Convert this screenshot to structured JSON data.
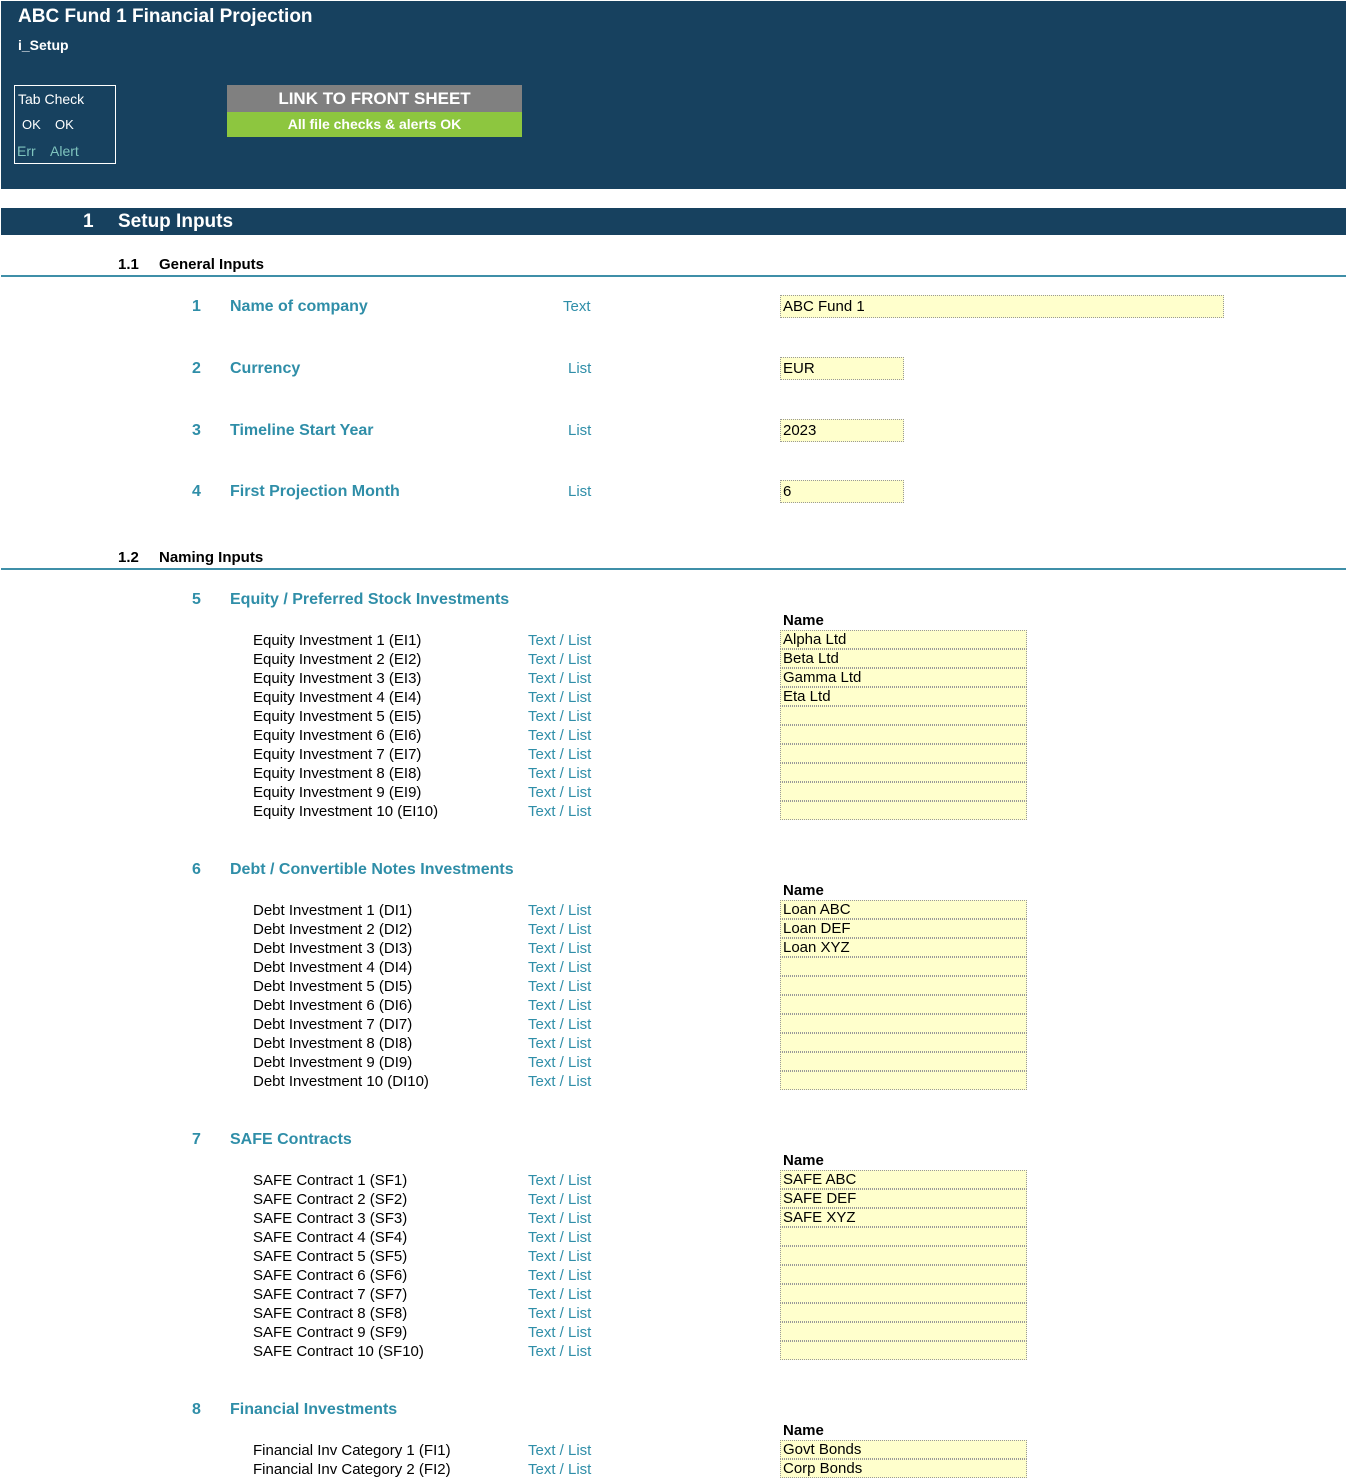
{
  "header": {
    "title": "ABC Fund 1 Financial Projection",
    "sheet": "i_Setup",
    "tab_check": {
      "title": "Tab Check",
      "ok1": "OK",
      "ok2": "OK",
      "err": "Err",
      "alert": "Alert"
    },
    "link_button": "LINK TO FRONT SHEET",
    "checks_status": "All file checks & alerts OK"
  },
  "section": {
    "num": "1",
    "title": "Setup Inputs"
  },
  "general": {
    "num": "1.1",
    "title": "General Inputs",
    "items": [
      {
        "num": "1",
        "label": "Name of company",
        "type": "Text",
        "value": "ABC Fund 1"
      },
      {
        "num": "2",
        "label": "Currency",
        "type": "List",
        "value": "EUR"
      },
      {
        "num": "3",
        "label": "Timeline Start Year",
        "type": "List",
        "value": "2023"
      },
      {
        "num": "4",
        "label": "First Projection Month",
        "type": "List",
        "value": "6"
      }
    ]
  },
  "naming": {
    "num": "1.2",
    "title": "Naming Inputs",
    "name_header": "Name",
    "groups": [
      {
        "num": "5",
        "title": "Equity / Preferred Stock Investments",
        "rows": [
          {
            "label": "Equity Investment 1 (EI1)",
            "type": "Text / List",
            "value": "Alpha Ltd"
          },
          {
            "label": "Equity Investment 2 (EI2)",
            "type": "Text / List",
            "value": "Beta Ltd"
          },
          {
            "label": "Equity Investment 3 (EI3)",
            "type": "Text / List",
            "value": "Gamma Ltd"
          },
          {
            "label": "Equity Investment 4 (EI4)",
            "type": "Text / List",
            "value": "Eta Ltd"
          },
          {
            "label": "Equity Investment 5 (EI5)",
            "type": "Text / List",
            "value": ""
          },
          {
            "label": "Equity Investment 6 (EI6)",
            "type": "Text / List",
            "value": ""
          },
          {
            "label": "Equity Investment 7 (EI7)",
            "type": "Text / List",
            "value": ""
          },
          {
            "label": "Equity Investment 8 (EI8)",
            "type": "Text / List",
            "value": ""
          },
          {
            "label": "Equity Investment 9 (EI9)",
            "type": "Text / List",
            "value": ""
          },
          {
            "label": "Equity Investment 10 (EI10)",
            "type": "Text / List",
            "value": ""
          }
        ]
      },
      {
        "num": "6",
        "title": "Debt / Convertible Notes Investments",
        "rows": [
          {
            "label": "Debt Investment 1 (DI1)",
            "type": "Text / List",
            "value": "Loan ABC"
          },
          {
            "label": "Debt Investment 2 (DI2)",
            "type": "Text / List",
            "value": "Loan DEF"
          },
          {
            "label": "Debt Investment 3 (DI3)",
            "type": "Text / List",
            "value": "Loan XYZ"
          },
          {
            "label": "Debt Investment 4 (DI4)",
            "type": "Text / List",
            "value": ""
          },
          {
            "label": "Debt Investment 5 (DI5)",
            "type": "Text / List",
            "value": ""
          },
          {
            "label": "Debt Investment 6 (DI6)",
            "type": "Text / List",
            "value": ""
          },
          {
            "label": "Debt Investment 7 (DI7)",
            "type": "Text / List",
            "value": ""
          },
          {
            "label": "Debt Investment 8 (DI8)",
            "type": "Text / List",
            "value": ""
          },
          {
            "label": "Debt Investment 9 (DI9)",
            "type": "Text / List",
            "value": ""
          },
          {
            "label": "Debt Investment 10 (DI10)",
            "type": "Text / List",
            "value": ""
          }
        ]
      },
      {
        "num": "7",
        "title": "SAFE Contracts",
        "rows": [
          {
            "label": "SAFE Contract 1 (SF1)",
            "type": "Text / List",
            "value": "SAFE ABC"
          },
          {
            "label": "SAFE Contract 2 (SF2)",
            "type": "Text / List",
            "value": "SAFE DEF"
          },
          {
            "label": "SAFE Contract 3 (SF3)",
            "type": "Text / List",
            "value": "SAFE XYZ"
          },
          {
            "label": "SAFE Contract 4 (SF4)",
            "type": "Text / List",
            "value": ""
          },
          {
            "label": "SAFE Contract 5 (SF5)",
            "type": "Text / List",
            "value": ""
          },
          {
            "label": "SAFE Contract 6 (SF6)",
            "type": "Text / List",
            "value": ""
          },
          {
            "label": "SAFE Contract 7 (SF7)",
            "type": "Text / List",
            "value": ""
          },
          {
            "label": "SAFE Contract 8 (SF8)",
            "type": "Text / List",
            "value": ""
          },
          {
            "label": "SAFE Contract 9 (SF9)",
            "type": "Text / List",
            "value": ""
          },
          {
            "label": "SAFE Contract 10 (SF10)",
            "type": "Text / List",
            "value": ""
          }
        ]
      },
      {
        "num": "8",
        "title": "Financial Investments",
        "rows": [
          {
            "label": "Financial Inv Category 1 (FI1)",
            "type": "Text / List",
            "value": "Govt Bonds"
          },
          {
            "label": "Financial Inv Category 2 (FI2)",
            "type": "Text / List",
            "value": "Corp Bonds"
          }
        ]
      }
    ]
  },
  "colors": {
    "navy": "#17415f",
    "teal": "#2f8ea8",
    "input_fill": "#ffffcc",
    "ok_green": "#8dc63f",
    "link_grey": "#808080",
    "err_teal": "#7fc4be"
  }
}
